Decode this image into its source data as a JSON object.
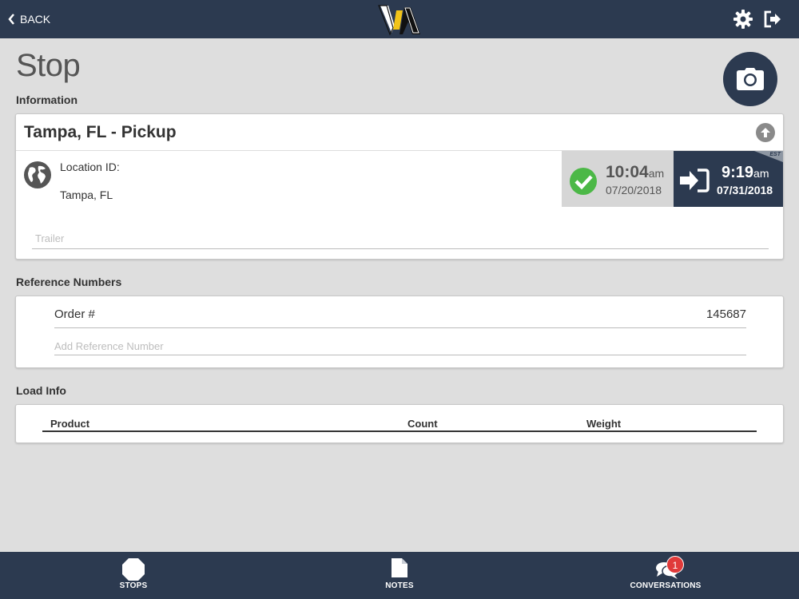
{
  "topbar": {
    "back_label": "BACK",
    "logo_text": "VIA"
  },
  "page": {
    "title": "Stop"
  },
  "information": {
    "section_label": "Information",
    "card_title": "Tampa, FL - Pickup",
    "location_label": "Location ID:",
    "location_value": "Tampa, FL",
    "arrived": {
      "time": "10:04",
      "ampm": "am",
      "date": "07/20/2018"
    },
    "checkin": {
      "time": "9:19",
      "ampm": "am",
      "date": "07/31/2018",
      "timezone": "EST"
    },
    "trailer_placeholder": "Trailer",
    "trailer_value": ""
  },
  "reference": {
    "section_label": "Reference Numbers",
    "rows": [
      {
        "key": "Order #",
        "value": "145687"
      }
    ],
    "add_placeholder": "Add Reference Number"
  },
  "load_info": {
    "section_label": "Load Info",
    "columns": [
      "Product",
      "Count",
      "Weight"
    ]
  },
  "bottom_nav": {
    "items": [
      {
        "label": "STOPS"
      },
      {
        "label": "NOTES"
      },
      {
        "label": "CONVERSATIONS",
        "badge": "1"
      }
    ]
  },
  "colors": {
    "navy": "#2c3a50",
    "background": "#dedede",
    "success": "#4cb847",
    "badge": "#e03a3a"
  },
  "icons": {
    "back": "chevron-left-icon",
    "settings": "gear-icon",
    "logout": "logout-icon",
    "camera": "camera-icon",
    "collapse": "arrow-up-circle-icon",
    "location": "globe-icon",
    "arrived": "check-circle-icon",
    "checkin": "sign-in-icon",
    "stops": "octagon-icon",
    "notes": "document-icon",
    "conversations": "chat-bubbles-icon"
  }
}
